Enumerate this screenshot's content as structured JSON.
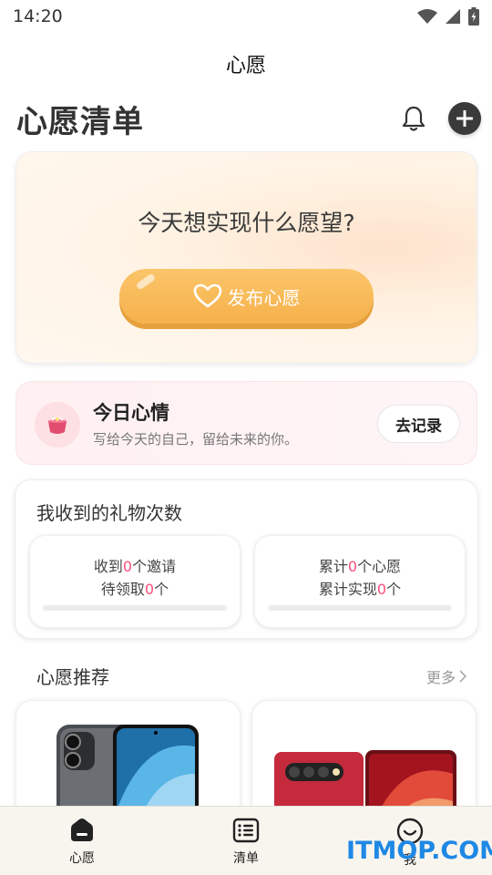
{
  "status_bar": {
    "time": "14:20",
    "icons": [
      "wifi-icon",
      "signal-icon",
      "battery-icon"
    ]
  },
  "app": {
    "title": "心愿"
  },
  "header": {
    "title": "心愿清单",
    "icons": [
      "bell-icon",
      "add-icon"
    ]
  },
  "hero": {
    "question": "今天想实现什么愿望?",
    "button_label": "发布心愿",
    "button_icon": "heart-icon"
  },
  "mood": {
    "title": "今日心情",
    "subtitle": "写给今天的自己，留给未来的你。",
    "button_label": "去记录",
    "icon": "ring-box-icon"
  },
  "gifts": {
    "title": "我收到的礼物次数",
    "left": {
      "l1_pre": "收到",
      "l1_num": "0",
      "l1_post": "个邀请",
      "l2_pre": "待领取",
      "l2_num": "0",
      "l2_post": "个"
    },
    "right": {
      "l1_pre": "累计",
      "l1_num": "0",
      "l1_post": "个心愿",
      "l2_pre": "累计实现",
      "l2_num": "0",
      "l2_post": "个"
    }
  },
  "recommend": {
    "title": "心愿推荐",
    "more_label": "更多"
  },
  "nav": {
    "items": [
      {
        "label": "心愿",
        "icon": "home-icon"
      },
      {
        "label": "清单",
        "icon": "list-icon"
      },
      {
        "label": "我",
        "icon": "smile-icon"
      }
    ]
  },
  "watermark": "ITMOP.COM",
  "colors": {
    "accent": "#f6b14b",
    "highlight_number": "#ff4d7a",
    "watermark": "#1e88e5"
  }
}
